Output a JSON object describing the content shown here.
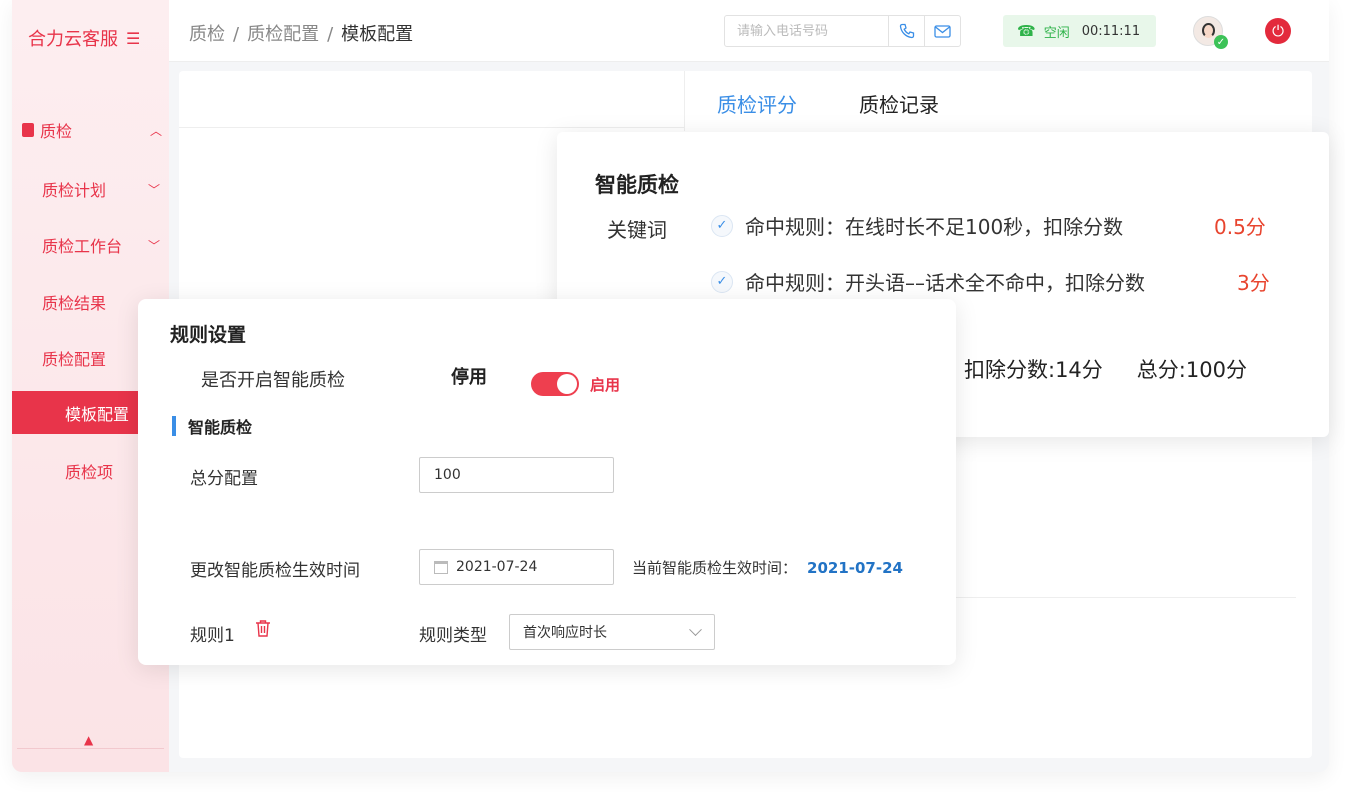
{
  "brand": {
    "name": "合力云客服",
    "menu_icon": "☰"
  },
  "sidebar": {
    "group": {
      "label": "质检",
      "icon": "qc-icon"
    },
    "items": [
      {
        "label": "质检计划"
      },
      {
        "label": "质检工作台"
      },
      {
        "label": "质检结果"
      },
      {
        "label": "质检配置"
      }
    ],
    "active_item": "模板配置",
    "sub_item": "质检项"
  },
  "header": {
    "breadcrumb": [
      "质检",
      "质检配置",
      "模板配置"
    ],
    "phone_placeholder": "请输入电话号码",
    "status": {
      "label": "空闲",
      "timer": "00:11:11",
      "color": "#2fb34a"
    }
  },
  "tabs": [
    {
      "label": "质检评分",
      "active": true
    },
    {
      "label": "质检记录",
      "active": false
    }
  ],
  "score_card": {
    "title": "智能质检",
    "category": "关键词",
    "rules": [
      {
        "text": "命中规则：在线时长不足100秒，扣除分数",
        "score": "0.5分"
      },
      {
        "text": "命中规则：开头语––话术全不命中，扣除分数",
        "score": "3分"
      }
    ],
    "deducted": "扣除分数:14分",
    "total": "总分:100分"
  },
  "rules_card": {
    "title": "规则设置",
    "question": "是否开启智能质检",
    "off_label": "停用",
    "on_label": "启用",
    "enabled": true,
    "section": "智能质检",
    "total_label": "总分配置",
    "total_value": "100",
    "date_label": "更改智能质检生效时间",
    "date_value": "2021-07-24",
    "current_label": "当前智能质检生效时间：",
    "current_value": "2021-07-24",
    "rule_name": "规则1",
    "rule_type_label": "规则类型",
    "rule_type_value": "首次响应时长"
  },
  "colors": {
    "accent": "#e8344a",
    "link": "#3a8ee6",
    "score": "#e8442e"
  }
}
